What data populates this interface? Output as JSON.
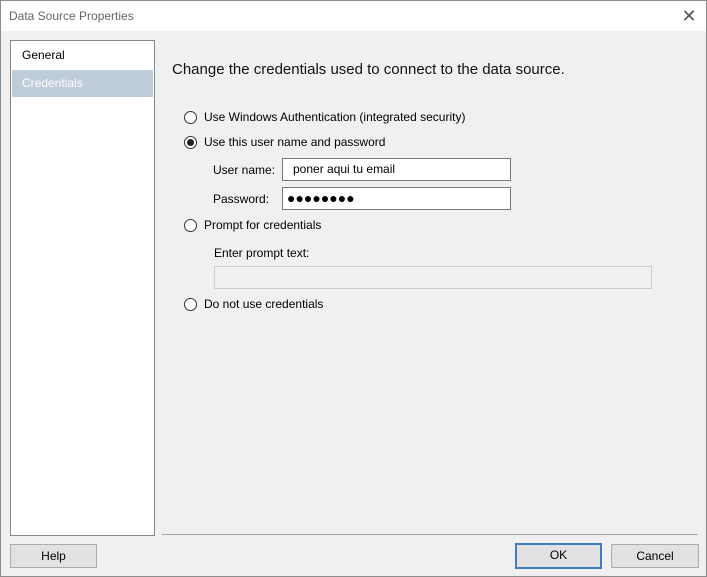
{
  "window": {
    "title": "Data Source Properties",
    "close_glyph": "✕"
  },
  "nav": {
    "items": [
      {
        "label": "General",
        "selected": false
      },
      {
        "label": "Credentials",
        "selected": true
      }
    ]
  },
  "content": {
    "heading": "Change the credentials used to connect to the data source.",
    "options": {
      "windows_auth": "Use Windows Authentication (integrated security)",
      "user_pass": "Use this user name and password",
      "prompt": "Prompt for credentials",
      "none": "Do not use credentials"
    },
    "selected_option": "user_pass",
    "username_label": "User name:",
    "username_value": "poner aqui tu email",
    "password_label": "Password:",
    "password_mask": "●●●●●●●●",
    "prompt_label": "Enter prompt text:",
    "prompt_value": ""
  },
  "footer": {
    "help": "Help",
    "ok": "OK",
    "cancel": "Cancel"
  },
  "colors": {
    "selected_nav": "#bfcddb",
    "default_button_border": "#3f7ec6"
  }
}
